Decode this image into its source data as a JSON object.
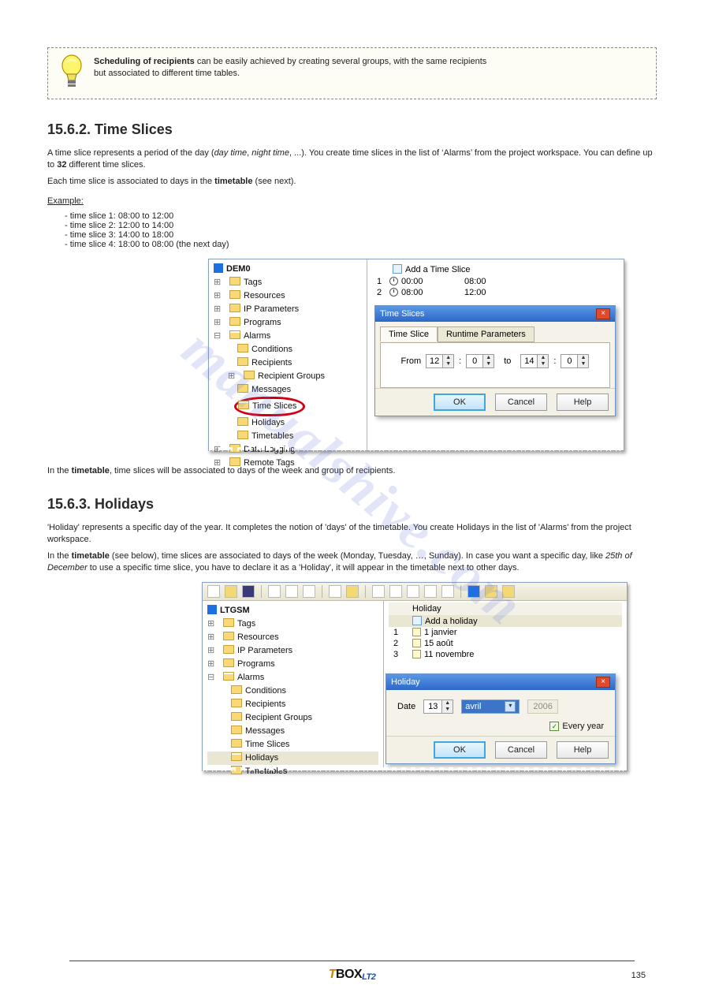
{
  "tip": {
    "line1": "Scheduling of recipients",
    "line2": "can be easily achieved by creating several groups, with the same recipients",
    "line3": "but associated to different time tables."
  },
  "sec_time": {
    "title": "15.6.2. Time Slices",
    "p1a": "A time slice represents a period of the day (",
    "p1b": "day time",
    "p1c": ", ",
    "p1d": "night time",
    "p1e": ", ...). You create time slices in the list of ‘Alarms’ from the project workspace. You can define up to ",
    "p1f": "32",
    "p1g": " different time slices.",
    "p2a": "Each time slice is associated to days in the ",
    "p2b": "timetable",
    "p2c": " (see next).",
    "ex_label": "Example:",
    "ex1": "-   time slice 1: 08:00 to 12:00",
    "ex2": "-   time slice 2: 12:00 to 14:00",
    "ex3": "-   time slice 3: 14:00 to 18:00",
    "ex4": "-   time slice 4: 18:00 to 08:00 (the next day)",
    "p3a": "In the ",
    "p3b": "timetable",
    "p3c": ", time slices will be associated to days of the week and group of recipients."
  },
  "sec_hol": {
    "title": "15.6.3. Holidays",
    "p1": "'Holiday' represents a specific day of the year. It completes the notion of 'days' of the timetable. You create Holidays in the list of 'Alarms' from the project workspace.",
    "p2a": "In the ",
    "p2b": "timetable",
    "p2c": " (see below), time slices are associated to days of the week (Monday, Tuesday, …, Sunday). In case you want a specific day, like ",
    "p2d": "25th of December",
    "p2e": " to use a specific time slice, you have to declare it as a 'Holiday', it will appear in the timetable next to other days."
  },
  "shot1": {
    "root": "DEM0",
    "tree": [
      "Tags",
      "Resources",
      "IP Parameters",
      "Programs",
      "Alarms"
    ],
    "alarm_children": [
      "Conditions",
      "Recipients",
      "Recipient Groups",
      "Messages",
      "Holidays",
      "Timetables"
    ],
    "time_slices_label": "Time Slices",
    "below": [
      "Data Logging",
      "Remote Tags"
    ],
    "add_label": "Add a Time Slice",
    "rows": [
      {
        "n": "1",
        "icon": "clock",
        "start": "00:00",
        "end": "08:00"
      },
      {
        "n": "2",
        "icon": "clock",
        "start": "08:00",
        "end": "12:00"
      }
    ],
    "dlg": {
      "title": "Time Slices",
      "tab1": "Time Slice",
      "tab2": "Runtime Parameters",
      "from": "From",
      "to": "to",
      "h1": "12",
      "m1": "0",
      "h2": "14",
      "m2": "0",
      "ok": "OK",
      "cancel": "Cancel",
      "help": "Help"
    }
  },
  "shot2": {
    "root": "LTGSM",
    "tree": [
      "Tags",
      "Resources",
      "IP Parameters",
      "Programs",
      "Alarms"
    ],
    "alarm_children": [
      "Conditions",
      "Recipients",
      "Recipient Groups",
      "Messages",
      "Time Slices",
      "Holidays",
      "Timetables"
    ],
    "hol_header": "Holiday",
    "add_label": "Add a holiday",
    "rows": [
      {
        "n": "1",
        "label": "1 janvier"
      },
      {
        "n": "2",
        "label": "15 août"
      },
      {
        "n": "3",
        "label": "11 novembre"
      }
    ],
    "dlg": {
      "title": "Holiday",
      "date_label": "Date",
      "day": "13",
      "month": "avril",
      "year": "2006",
      "every_year": "Every year",
      "ok": "OK",
      "cancel": "Cancel",
      "help": "Help"
    }
  },
  "watermark": "manualshive.com",
  "footer": {
    "logo_t": "T",
    "logo_box": "BOX",
    "logo_sub": "LT2"
  },
  "page_number": "135"
}
